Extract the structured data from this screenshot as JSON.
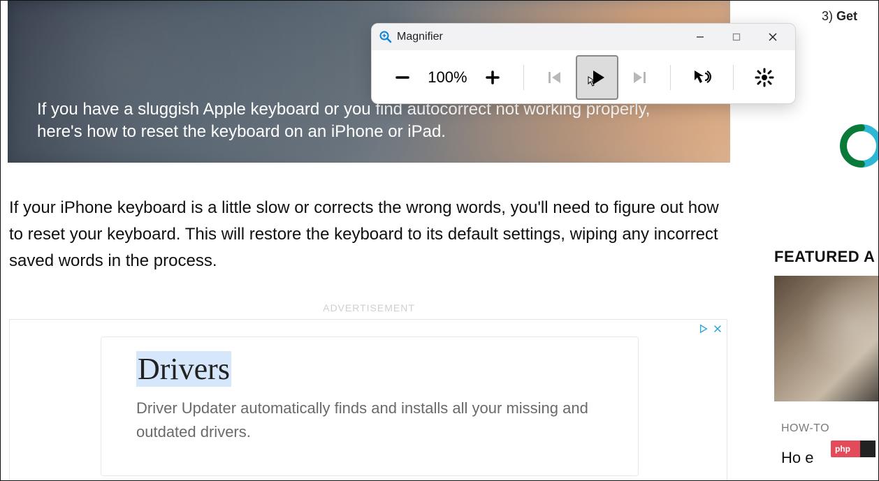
{
  "hero": {
    "text": "If you have a sluggish Apple keyboard or you find autocorrect not working properly, here's how to reset the keyboard on an iPhone or iPad."
  },
  "article": {
    "paragraph": "If your iPhone keyboard is a little slow or corrects the wrong words, you'll need to figure out how to reset your keyboard. This will restore the keyboard to its default settings, wiping any incorrect saved words in the process."
  },
  "ad": {
    "label": "ADVERTISEMENT",
    "title": "Drivers",
    "copy": "Driver Updater automatically finds and installs all your missing and outdated drivers."
  },
  "sidebar": {
    "list_number": "3)",
    "list_text": "Get",
    "featured_label": "FEATURED A",
    "howto": "HOW-TO",
    "featured_title": "Ho                e",
    "php_badge": "php"
  },
  "magnifier": {
    "title": "Magnifier",
    "zoom": "100%"
  }
}
